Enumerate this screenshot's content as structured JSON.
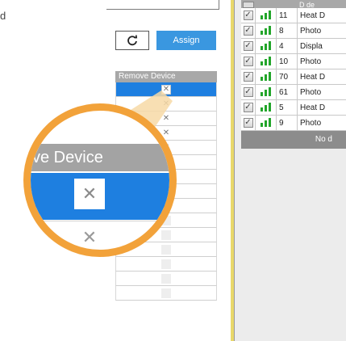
{
  "left": {
    "fragment_text": "d",
    "refresh_icon": "refresh-icon",
    "assign_label": "Assign",
    "remove_header": "Remove Device",
    "remove_rows": [
      {
        "icon": "close-icon",
        "selected": true,
        "active": true
      },
      {
        "icon": "close-icon",
        "selected": false,
        "active": true
      },
      {
        "icon": "close-icon",
        "selected": false,
        "active": true
      },
      {
        "icon": "close-icon",
        "selected": false,
        "active": true
      },
      {
        "icon": "close-icon",
        "selected": false,
        "active": true
      },
      {
        "icon": "close-icon",
        "selected": false,
        "active": true
      },
      {
        "icon": "close-icon",
        "selected": false,
        "active": true
      },
      {
        "icon": "close-icon",
        "selected": false,
        "active": true
      },
      {
        "icon": "close-icon",
        "selected": false,
        "active": true
      },
      {
        "icon": "close-icon",
        "selected": false,
        "active": false
      },
      {
        "icon": "close-icon",
        "selected": false,
        "active": false
      },
      {
        "icon": "close-icon",
        "selected": false,
        "active": false
      },
      {
        "icon": "close-icon",
        "selected": false,
        "active": false
      },
      {
        "icon": "close-icon",
        "selected": false,
        "active": false
      },
      {
        "icon": "close-icon",
        "selected": false,
        "active": false
      }
    ],
    "magnifier": {
      "header": "ve Device",
      "accent": "#f2a23a",
      "selected_color": "#1e7fe0"
    }
  },
  "right": {
    "header_fragment": "D de",
    "devices": [
      {
        "checked": true,
        "signal": 3,
        "id": "11",
        "type": "Heat D"
      },
      {
        "checked": true,
        "signal": 3,
        "id": "8",
        "type": "Photo"
      },
      {
        "checked": true,
        "signal": 3,
        "id": "4",
        "type": "Displa"
      },
      {
        "checked": true,
        "signal": 3,
        "id": "10",
        "type": "Photo"
      },
      {
        "checked": true,
        "signal": 3,
        "id": "70",
        "type": "Heat D"
      },
      {
        "checked": true,
        "signal": 3,
        "id": "61",
        "type": "Photo"
      },
      {
        "checked": true,
        "signal": 3,
        "id": "5",
        "type": "Heat D"
      },
      {
        "checked": true,
        "signal": 3,
        "id": "9",
        "type": "Photo"
      }
    ],
    "footer_text": "No d",
    "signal_color": "#22a52a",
    "divider_color": "#e9d86a"
  }
}
